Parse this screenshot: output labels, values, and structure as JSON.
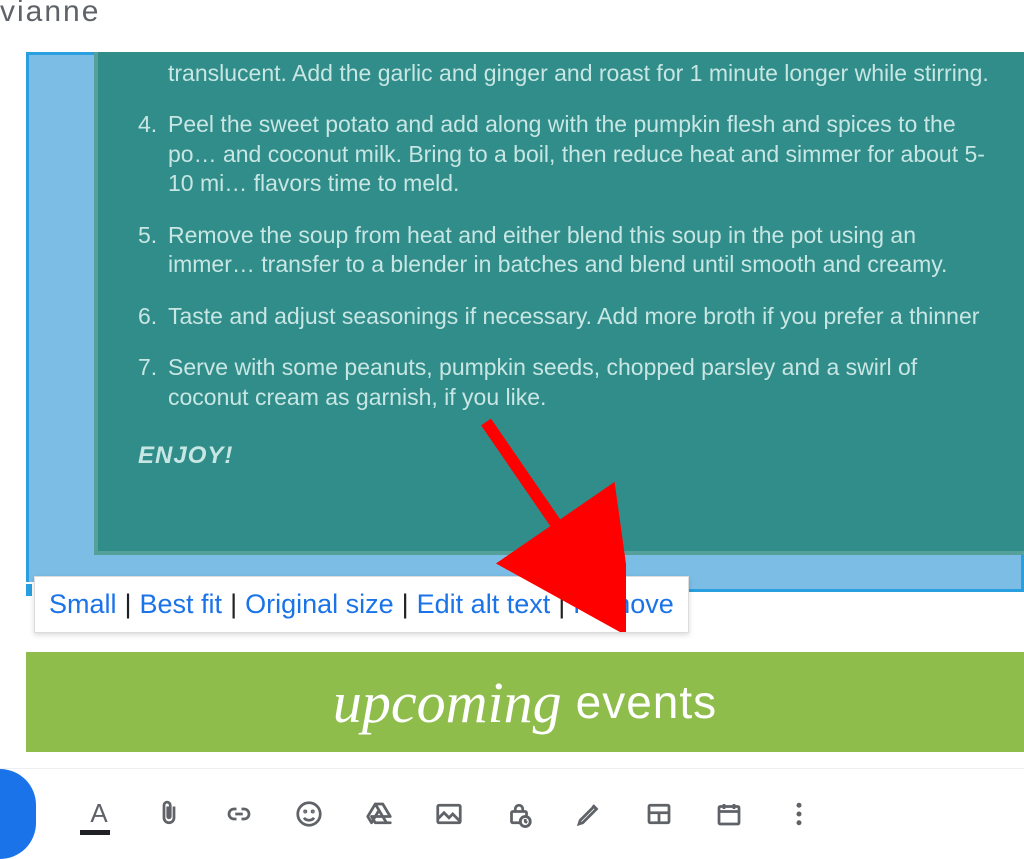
{
  "top_cropped_text": "vianne",
  "recipe": {
    "step3_partial": "translucent. Add the garlic and ginger and roast for 1 minute longer while stirring.",
    "step4": "Peel the sweet potato and add along with the pumpkin flesh and spices to the po… and coconut milk. Bring to a boil, then reduce heat and simmer for about 5-10 mi… flavors time to meld.",
    "step5": "Remove the soup from heat and either blend this soup in the pot using an immer… transfer to a blender in batches and blend until smooth and creamy.",
    "step6": "Taste and adjust seasonings if necessary. Add more broth if you prefer a thinner",
    "step7": "Serve with some peanuts, pumpkin seeds, chopped parsley and a swirl of coconut cream as garnish, if you like.",
    "enjoy": "ENJOY!"
  },
  "image_popup": {
    "small": "Small",
    "best_fit": "Best fit",
    "original_size": "Original size",
    "edit_alt_text": "Edit alt text",
    "remove": "Remove"
  },
  "banner": {
    "script": "upcoming",
    "plain": "events"
  },
  "toolbar": {
    "text_color_letter": "A"
  }
}
